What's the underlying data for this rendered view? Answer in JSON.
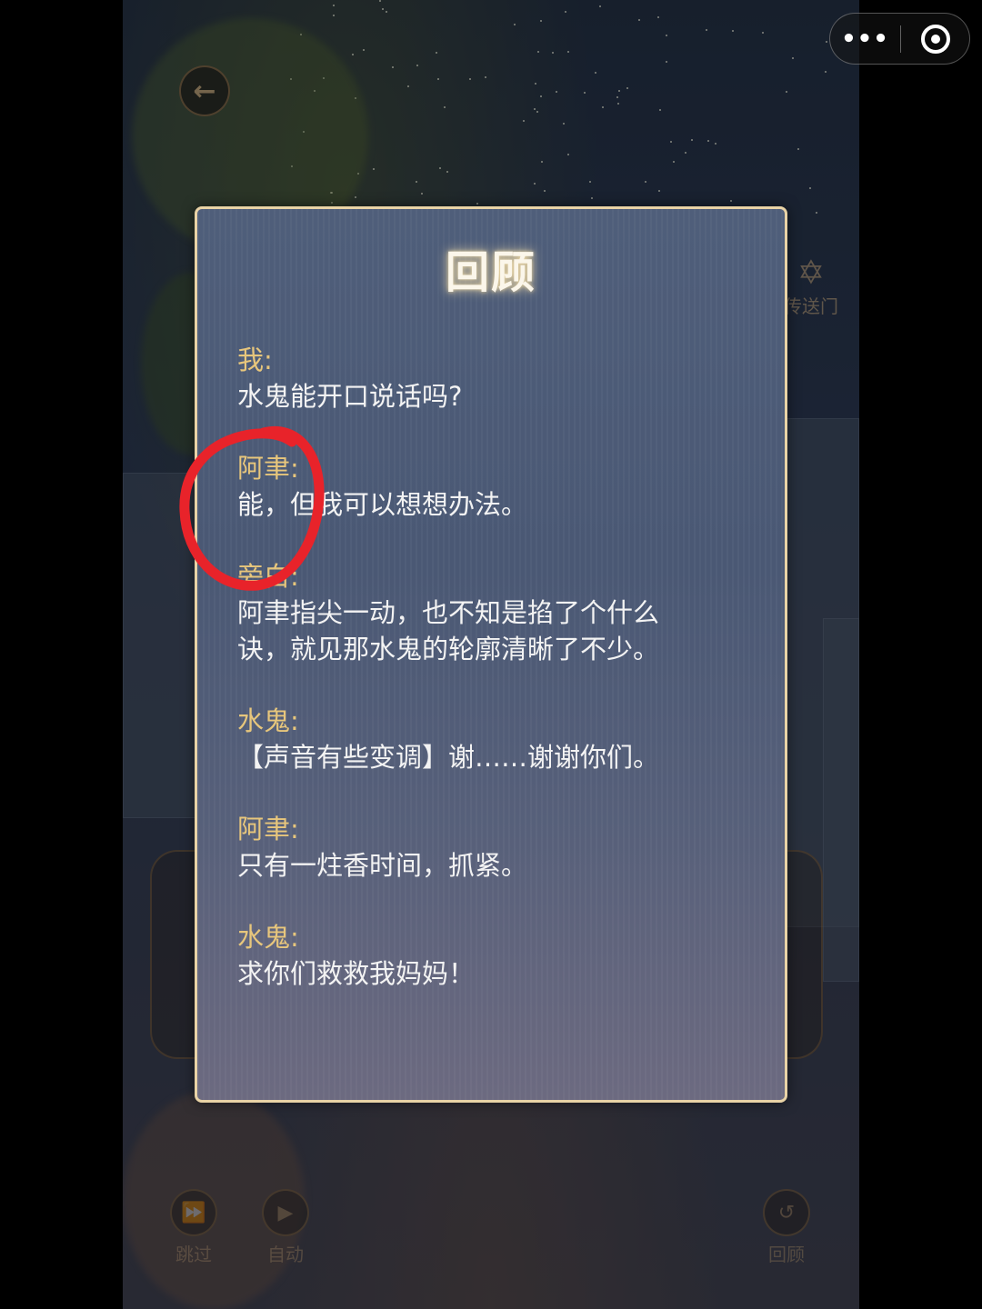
{
  "panel": {
    "title": "回顾",
    "entries": [
      {
        "speaker": "我:",
        "text": [
          "水鬼能开口说话吗?"
        ]
      },
      {
        "speaker": "阿聿:",
        "text": [
          "能，但我可以想想办法。"
        ]
      },
      {
        "speaker": "旁白:",
        "text": [
          "阿聿指尖一动，也不知是掐了个什么",
          "诀，就见那水鬼的轮廓清晰了不少。"
        ]
      },
      {
        "speaker": "水鬼:",
        "text": [
          "【声音有些变调】谢……谢谢你们。"
        ]
      },
      {
        "speaker": "阿聿:",
        "text": [
          "只有一炷香时间，抓紧。"
        ]
      },
      {
        "speaker": "水鬼:",
        "text": [
          "求你们救救我妈妈！"
        ]
      }
    ]
  },
  "background": {
    "portal_label": "传送门",
    "buttons": {
      "skip": "跳过",
      "auto": "自动",
      "review": "回顾"
    }
  },
  "colors": {
    "speaker": "#e7c67c",
    "text": "#f3f3f3",
    "panel_border": "#e9d3a6",
    "annotation": "#e8232a"
  },
  "icons": {
    "back": "arrow-left-icon",
    "more": "more-dots-icon",
    "close": "target-close-icon",
    "portal": "star-of-david-icon",
    "skip": "fast-forward-icon",
    "auto": "play-icon",
    "review": "rewind-icon"
  }
}
